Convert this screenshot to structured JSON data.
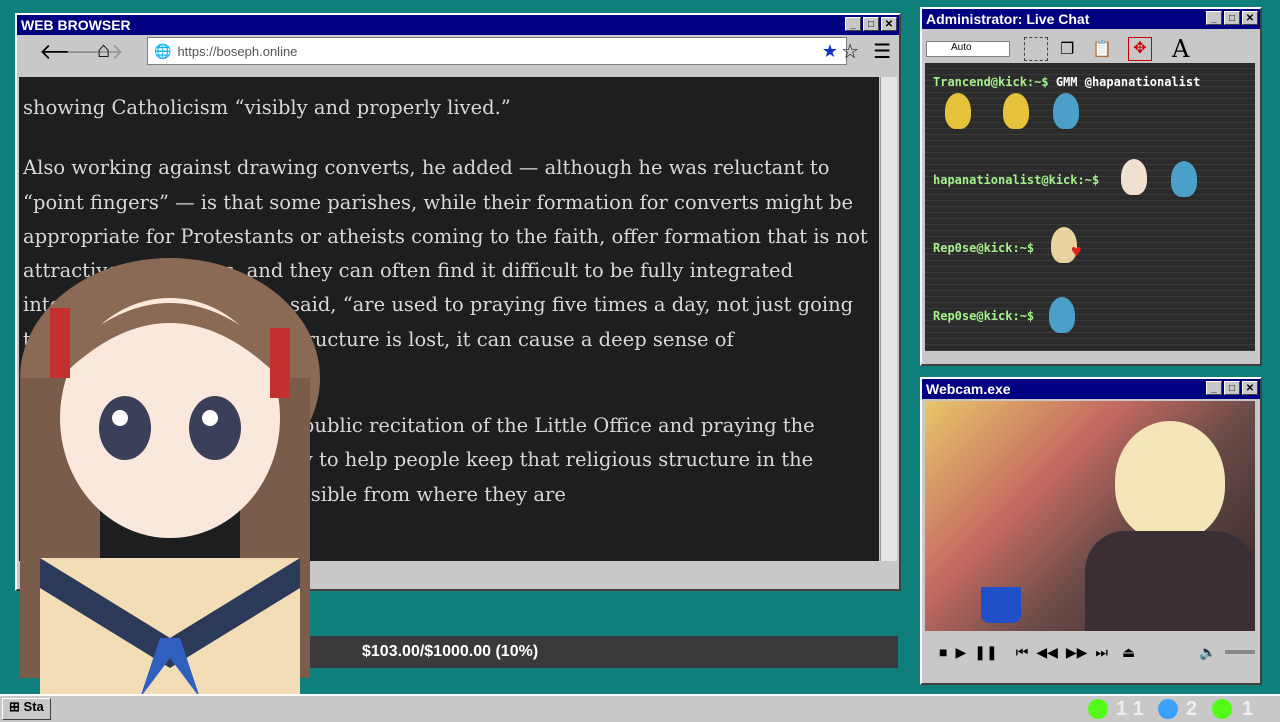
{
  "browser": {
    "title": "WEB BROWSER",
    "url": "https://boseph.online",
    "article_lines": [
      "showing Catholicism “visibly and properly lived.”",
      "",
      "Also working against drawing converts, he added — although he was reluctant to",
      "“point fingers” — is that some parishes, while their formation for converts might be",
      "appropriate for Protestants or atheists coming to the faith, offer formation that is not",
      "attractive to Muslims, and they can often find it difficult to be fully integrated",
      "into parishes. Muslims, he said, “are used to praying five times a day, not just going",
      "to Mass on Sunday. If that structure is lost, it can cause a deep sense of",
      "",
      "",
      "“Our community provides a public recitation of the Little Office and praying the",
      "Liturgy of the Hours. “We try to help people keep that religious structure in the",
      "transition as seamless as possible from where they are"
    ]
  },
  "chat": {
    "title": "Administrator: Live Chat",
    "font_select": "Auto",
    "messages": [
      {
        "user": "Trancend@kick:~$",
        "text": "GMM @hapanationalist"
      },
      {
        "user": "hapanationalist@kick:~$",
        "text": ""
      },
      {
        "user": "Rep0se@kick:~$",
        "text": ""
      },
      {
        "user": "Rep0se@kick:~$",
        "text": ""
      }
    ]
  },
  "webcam": {
    "title": "Webcam.exe"
  },
  "donation": {
    "text": "$103.00/$1000.00 (10%)",
    "progress": 0.1
  },
  "taskbar": {
    "start_label": "Sta",
    "tray": [
      {
        "icon": "kick-icon",
        "count": "1 1",
        "color": "#53fc18"
      },
      {
        "icon": "moon-icon",
        "count": "2",
        "color": "#3aa0ff"
      },
      {
        "icon": "play-icon",
        "count": "1",
        "color": "#53fc18"
      }
    ]
  }
}
